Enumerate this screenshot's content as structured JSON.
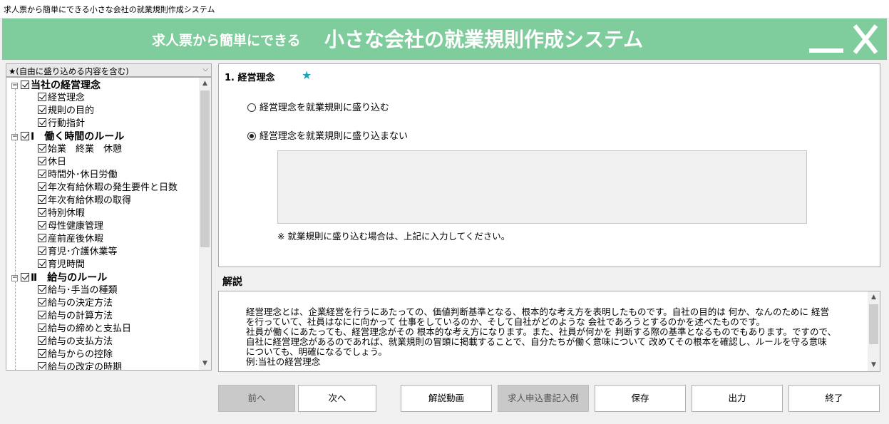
{
  "window": {
    "title": "求人票から簡単にできる小さな会社の就業規則作成システム"
  },
  "banner": {
    "title_small": "求人票から簡単にできる",
    "title_large": "小さな会社の就業規則作成システム"
  },
  "combo": {
    "selected": "★(自由に盛り込める内容を含む)"
  },
  "tree": {
    "sections": [
      {
        "label": "当社の経営理念",
        "items": [
          "経営理念",
          "規則の目的",
          "行動指針"
        ]
      },
      {
        "label": "Ⅰ　働く時間のルール",
        "items": [
          "始業　終業　休憩",
          "休日",
          "時間外･休日労働",
          "年次有給休暇の発生要件と日数",
          "年次有給休暇の取得",
          "特別休暇",
          "母性健康管理",
          "産前産後休暇",
          "育児･介護休業等",
          "育児時間"
        ]
      },
      {
        "label": "Ⅱ　給与のルール",
        "items": [
          "給与･手当の種類",
          "給与の決定方法",
          "給与の計算方法",
          "給与の締めと支払日",
          "給与の支払方法",
          "給与からの控除",
          "給与の改定の時期"
        ]
      }
    ]
  },
  "main": {
    "section_title": "1. 経営理念",
    "star": "★",
    "option_include": "経営理念を就業規則に盛り込む",
    "option_exclude": "経営理念を就業規則に盛り込まない",
    "note": "※ 就業規則に盛り込む場合は、上記に入力してください。"
  },
  "kaisetsu": {
    "title": "解説",
    "lines": [
      "経営理念とは、企業経営を行うにあたっての、価値判断基準となる、根本的な考え方を表明したものです。自社の目的は 何か、なんのために 経営",
      "を行っていて、社員はなにに向かって 仕事をしているのか、そして自社がどのような 会社であろうとするのかを述べたものです。",
      "社員が働くにあたっても、経営理念がその 根本的な考え方になります。また、社員が何かを 判断する際の基準となるものでもあります。ですので、",
      "自社に経営理念があるのであれば、就業規則の冒頭に掲載することで、自分たちが働く意味について 改めてその根本を確認し、ルールを守る意味",
      "についても、明確になるでしょう。",
      "例:当社の経営理念"
    ]
  },
  "buttons": {
    "prev": "前へ",
    "next": "次へ",
    "video": "解説動画",
    "example": "求人申込書記入例",
    "save": "保存",
    "output": "出力",
    "exit": "終了"
  }
}
